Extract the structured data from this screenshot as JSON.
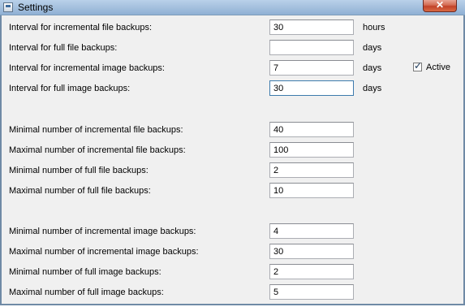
{
  "window": {
    "title": "Settings",
    "close_symbol": "✕",
    "icon": "settings-app-icon"
  },
  "rows": [
    {
      "label": "Interval for incremental file backups:",
      "value": "30",
      "unit": "hours"
    },
    {
      "label": "Interval for full file backups:",
      "value": "",
      "unit": "days"
    },
    {
      "label": "Interval for incremental image backups:",
      "value": "7",
      "unit": "days"
    },
    {
      "label": "Interval for full image backups:",
      "value": "30",
      "unit": "days"
    },
    {
      "label": "Minimal number of incremental file backups:",
      "value": "40"
    },
    {
      "label": "Maximal number of incremental file backups:",
      "value": "100"
    },
    {
      "label": "Minimal number of full file backups:",
      "value": "2"
    },
    {
      "label": "Maximal number of full file backups:",
      "value": "10"
    },
    {
      "label": "Minimal number of incremental image backups:",
      "value": "4"
    },
    {
      "label": "Maximal number of incremental image backups:",
      "value": "30"
    },
    {
      "label": "Minimal number of full image backups:",
      "value": "2"
    },
    {
      "label": "Maximal number of full image backups:",
      "value": "5"
    }
  ],
  "active_checkbox": {
    "label": "Active",
    "checked": true,
    "check_glyph": "✓"
  },
  "colors": {
    "titlebar": "#a7c2df",
    "close_button": "#c24228",
    "window_bg": "#f0f0f0",
    "focus_border": "#3d7bad"
  }
}
